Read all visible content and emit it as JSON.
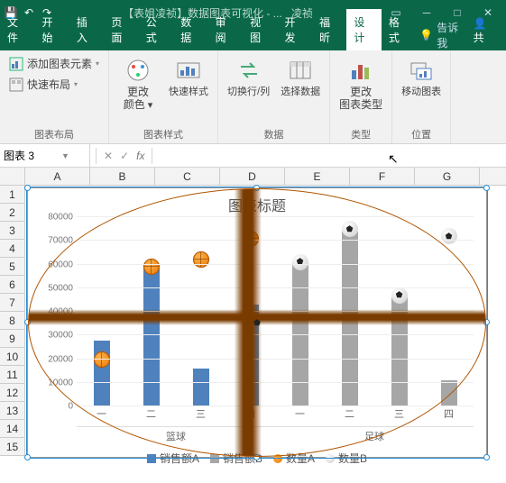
{
  "titlebar": {
    "doc_title": "【表姐凌祯】数据图表可视化 - ...",
    "user": "凌祯"
  },
  "tabs": {
    "items": [
      "文件",
      "开始",
      "插入",
      "页面",
      "公式",
      "数据",
      "审阅",
      "视图",
      "开发",
      "福昕",
      "设计",
      "格式"
    ],
    "active_index": 10,
    "tellme": "告诉我",
    "share": "共"
  },
  "ribbon": {
    "g0": {
      "label": "图表布局",
      "add_elem": "添加图表元素",
      "quick_layout": "快速布局"
    },
    "g1": {
      "label": "图表样式",
      "change_colors_l1": "更改",
      "change_colors_l2": "颜色",
      "quick_style": "快速样式"
    },
    "g2": {
      "label": "数据",
      "switch_rc": "切换行/列",
      "select_data": "选择数据"
    },
    "g3": {
      "label": "类型",
      "change_type_l1": "更改",
      "change_type_l2": "图表类型"
    },
    "g4": {
      "label": "位置",
      "move_chart": "移动图表"
    }
  },
  "namebox": {
    "value": "图表 3"
  },
  "formula_bar": {
    "fx": "fx",
    "value": ""
  },
  "columns": [
    "A",
    "B",
    "C",
    "D",
    "E",
    "F",
    "G"
  ],
  "rows": [
    "1",
    "2",
    "3",
    "4",
    "5",
    "6",
    "7",
    "8",
    "9",
    "10",
    "11",
    "12",
    "13",
    "14",
    "15"
  ],
  "chart_data": {
    "type": "bar",
    "title": "图表标题",
    "ylabel": "",
    "ylim": [
      0,
      80000
    ],
    "ytick": 10000,
    "groups": [
      "篮球",
      "足球"
    ],
    "categories": [
      "一",
      "二",
      "三",
      "四",
      "一",
      "二",
      "三",
      "四"
    ],
    "group_of_cat": [
      0,
      0,
      0,
      0,
      1,
      1,
      1,
      1
    ],
    "series": [
      {
        "name": "销售额A",
        "kind": "bar",
        "color": "#4f81bd",
        "values": [
          28000,
          60000,
          16000,
          43000,
          null,
          null,
          null,
          null
        ]
      },
      {
        "name": "销售额B",
        "kind": "bar",
        "color": "#a6a6a6",
        "values": [
          null,
          null,
          null,
          null,
          61000,
          74000,
          46000,
          11000
        ]
      },
      {
        "name": "数量A",
        "kind": "marker",
        "icon": "basketball",
        "values": [
          20000,
          59000,
          62000,
          71000,
          null,
          null,
          null,
          null
        ]
      },
      {
        "name": "数量B",
        "kind": "marker",
        "icon": "soccer",
        "values": [
          null,
          null,
          null,
          null,
          61000,
          75000,
          47000,
          72000
        ]
      }
    ],
    "legend": [
      "销售额A",
      "销售额B",
      "数量A",
      "数量B"
    ]
  }
}
